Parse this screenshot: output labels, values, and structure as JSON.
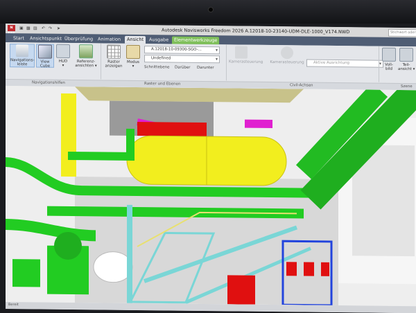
{
  "app": {
    "logo_text": "N FRE",
    "title": "Autodesk Navisworks Freedom 2026   A.12018-10-23140-UDM-DLE-1000_V174.NWD",
    "search_placeholder": "Stichwort oder"
  },
  "tabs": [
    {
      "label": "Start"
    },
    {
      "label": "Ansichtspunkt"
    },
    {
      "label": "Überprüfung"
    },
    {
      "label": "Animation"
    },
    {
      "label": "Ansicht"
    },
    {
      "label": "Ausgabe"
    },
    {
      "label": "Elementwerkzeuge"
    }
  ],
  "ribbon": {
    "nav_tools": [
      {
        "label": "Navigations-\nleiste"
      },
      {
        "label": "View\nCube"
      },
      {
        "label": "HUD\n▾"
      },
      {
        "label": "Referenz-\nansichten ▾"
      }
    ],
    "grid": {
      "show_label": "Raster\nanzeigen",
      "mode_label": "Modus\n▾"
    },
    "level_combo": "A.12018-10-09300-SGO-...",
    "level_combo2": "Undefined",
    "section_label": "Schnittebene",
    "above_label": "Darüber",
    "below_label": "Darunter",
    "camera_control": "Kamerasteuerung",
    "camera_control2": "Kamerasteuerung",
    "active_camera": "Aktive Ausrichtung",
    "fullscreen": "Voll-\nbild",
    "split": "Teil-\nansicht ▾",
    "panels": {
      "nav": "Navigationshilfen",
      "grid": "Raster und Ebenen",
      "civil": "Civil-Achsen",
      "scene": "Szene"
    }
  },
  "colors": {
    "ribbon_tabs": "#4f5d74",
    "context_tab": "#7fbf5a",
    "pipe_green": "#22cc22",
    "tank_yellow": "#f2ee1e",
    "steel_cyan": "#7ad6d6",
    "valve_red": "#e01010",
    "pipe_magenta": "#e020d0",
    "frame_blue": "#2244dd"
  },
  "status": {
    "left": "Bereit"
  }
}
